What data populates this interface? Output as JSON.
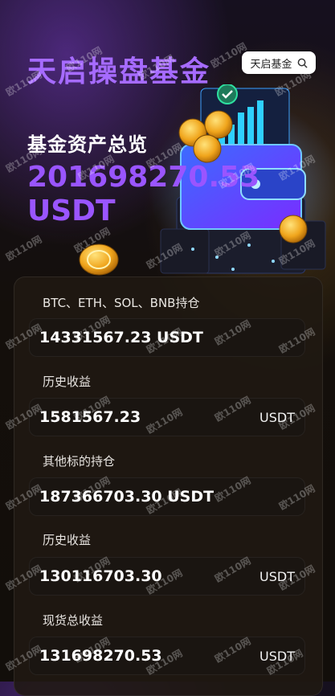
{
  "header": {
    "title": "天启操盘基金",
    "search_button_label": "天启基金"
  },
  "overview": {
    "label": "基金资产总览",
    "total_value": "201698270.53",
    "total_unit": "USDT"
  },
  "sections": [
    {
      "label": "BTC、ETH、SOL、BNB持仓",
      "value": "14331567.23 USDT",
      "unit": ""
    },
    {
      "label": "历史收益",
      "value": "1581567.23",
      "unit": "USDT"
    },
    {
      "label": "其他标的持仓",
      "value": "187366703.30 USDT",
      "unit": ""
    },
    {
      "label": "历史收益",
      "value": "130116703.30",
      "unit": "USDT"
    },
    {
      "label": "现货总收益",
      "value": "131698270.53",
      "unit": "USDT"
    }
  ],
  "watermark": "欧110网",
  "colors": {
    "title": "#a66bff",
    "total": "#9a55ff",
    "panel_bg": "#201912"
  },
  "icons": [
    "search-icon",
    "wallet-illustration",
    "coin-icon",
    "checkmark-icon"
  ]
}
